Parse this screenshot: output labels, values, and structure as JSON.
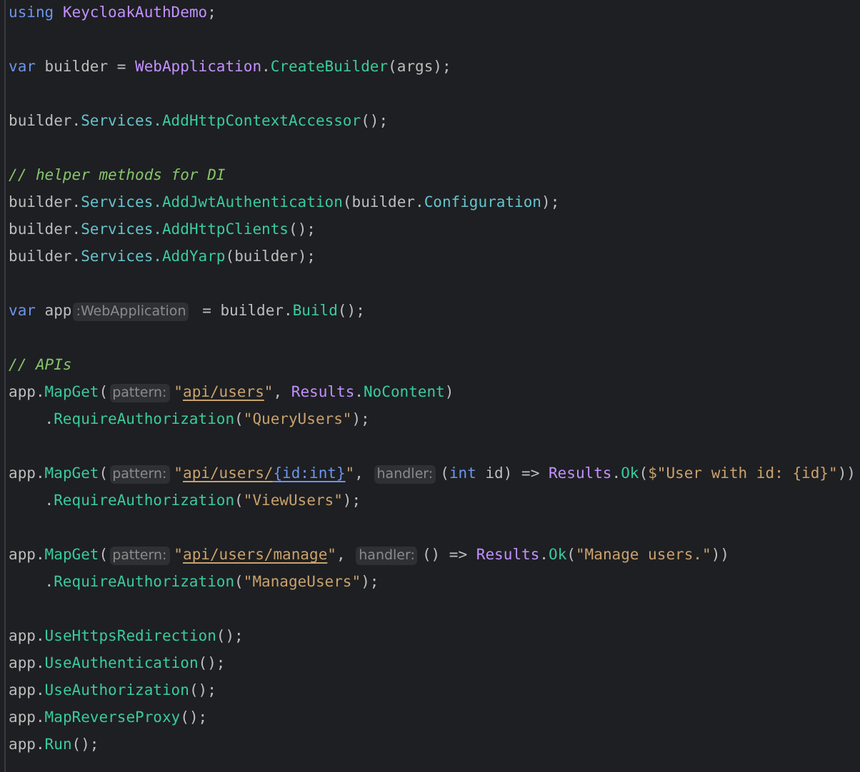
{
  "editor": {
    "lines": [
      {
        "kind": "code",
        "tokens": [
          {
            "kind": "keyword",
            "text": "using "
          },
          {
            "kind": "type",
            "text": "KeycloakAuthDemo"
          },
          {
            "kind": "plain",
            "text": ";"
          }
        ]
      },
      {
        "kind": "blank"
      },
      {
        "kind": "code",
        "tokens": [
          {
            "kind": "keyword",
            "text": "var"
          },
          {
            "kind": "plain",
            "text": " builder = "
          },
          {
            "kind": "type",
            "text": "WebApplication"
          },
          {
            "kind": "plain",
            "text": "."
          },
          {
            "kind": "method",
            "text": "CreateBuilder"
          },
          {
            "kind": "plain",
            "text": "(args);"
          }
        ]
      },
      {
        "kind": "blank"
      },
      {
        "kind": "code",
        "tokens": [
          {
            "kind": "plain",
            "text": "builder."
          },
          {
            "kind": "property",
            "text": "Services."
          },
          {
            "kind": "method",
            "text": "AddHttpContextAccessor"
          },
          {
            "kind": "plain",
            "text": "();"
          }
        ]
      },
      {
        "kind": "blank"
      },
      {
        "kind": "code",
        "tokens": [
          {
            "kind": "comment",
            "text": "// helper methods for DI"
          }
        ]
      },
      {
        "kind": "code",
        "tokens": [
          {
            "kind": "plain",
            "text": "builder."
          },
          {
            "kind": "property",
            "text": "Services."
          },
          {
            "kind": "method",
            "text": "AddJwtAuthentication"
          },
          {
            "kind": "plain",
            "text": "(builder."
          },
          {
            "kind": "property",
            "text": "Configuration"
          },
          {
            "kind": "plain",
            "text": ");"
          }
        ]
      },
      {
        "kind": "code",
        "tokens": [
          {
            "kind": "plain",
            "text": "builder."
          },
          {
            "kind": "property",
            "text": "Services."
          },
          {
            "kind": "method",
            "text": "AddHttpClients"
          },
          {
            "kind": "plain",
            "text": "();"
          }
        ]
      },
      {
        "kind": "code",
        "tokens": [
          {
            "kind": "plain",
            "text": "builder."
          },
          {
            "kind": "property",
            "text": "Services."
          },
          {
            "kind": "method",
            "text": "AddYarp"
          },
          {
            "kind": "plain",
            "text": "(builder);"
          }
        ]
      },
      {
        "kind": "blank"
      },
      {
        "kind": "code",
        "tokens": [
          {
            "kind": "keyword",
            "text": "var"
          },
          {
            "kind": "plain",
            "text": " app"
          },
          {
            "kind": "hint",
            "text": ":WebApplication"
          },
          {
            "kind": "plain",
            "text": " = builder."
          },
          {
            "kind": "method",
            "text": "Build"
          },
          {
            "kind": "plain",
            "text": "();"
          }
        ]
      },
      {
        "kind": "blank"
      },
      {
        "kind": "code",
        "tokens": [
          {
            "kind": "comment",
            "text": "// APIs"
          }
        ]
      },
      {
        "kind": "code",
        "tokens": [
          {
            "kind": "plain",
            "text": "app."
          },
          {
            "kind": "method",
            "text": "MapGet"
          },
          {
            "kind": "plain",
            "text": "("
          },
          {
            "kind": "hint",
            "text": "pattern:"
          },
          {
            "kind": "string",
            "text": "\""
          },
          {
            "kind": "route",
            "text": "api/users"
          },
          {
            "kind": "string",
            "text": "\""
          },
          {
            "kind": "plain",
            "text": ", "
          },
          {
            "kind": "type",
            "text": "Results"
          },
          {
            "kind": "plain",
            "text": "."
          },
          {
            "kind": "method",
            "text": "NoContent"
          },
          {
            "kind": "plain",
            "text": ")"
          }
        ]
      },
      {
        "kind": "code",
        "tokens": [
          {
            "kind": "plain",
            "text": "    ."
          },
          {
            "kind": "method",
            "text": "RequireAuthorization"
          },
          {
            "kind": "plain",
            "text": "("
          },
          {
            "kind": "string",
            "text": "\"QueryUsers\""
          },
          {
            "kind": "plain",
            "text": ");"
          }
        ]
      },
      {
        "kind": "blank"
      },
      {
        "kind": "code",
        "tokens": [
          {
            "kind": "plain",
            "text": "app."
          },
          {
            "kind": "method",
            "text": "MapGet"
          },
          {
            "kind": "plain",
            "text": "("
          },
          {
            "kind": "hint",
            "text": "pattern:"
          },
          {
            "kind": "string",
            "text": "\""
          },
          {
            "kind": "route",
            "text": "api/users/"
          },
          {
            "kind": "param",
            "text": "{id:int}"
          },
          {
            "kind": "string",
            "text": "\""
          },
          {
            "kind": "plain",
            "text": ", "
          },
          {
            "kind": "hint",
            "text": "handler:"
          },
          {
            "kind": "plain",
            "text": "("
          },
          {
            "kind": "keyword",
            "text": "int"
          },
          {
            "kind": "plain",
            "text": " id) => "
          },
          {
            "kind": "type",
            "text": "Results"
          },
          {
            "kind": "plain",
            "text": "."
          },
          {
            "kind": "method",
            "text": "Ok"
          },
          {
            "kind": "plain",
            "text": "("
          },
          {
            "kind": "string",
            "text": "$\"User with id: {id}\""
          },
          {
            "kind": "plain",
            "text": "))"
          }
        ]
      },
      {
        "kind": "code",
        "tokens": [
          {
            "kind": "plain",
            "text": "    ."
          },
          {
            "kind": "method",
            "text": "RequireAuthorization"
          },
          {
            "kind": "plain",
            "text": "("
          },
          {
            "kind": "string",
            "text": "\"ViewUsers\""
          },
          {
            "kind": "plain",
            "text": ");"
          }
        ]
      },
      {
        "kind": "blank"
      },
      {
        "kind": "code",
        "tokens": [
          {
            "kind": "plain",
            "text": "app."
          },
          {
            "kind": "method",
            "text": "MapGet"
          },
          {
            "kind": "plain",
            "text": "("
          },
          {
            "kind": "hint",
            "text": "pattern:"
          },
          {
            "kind": "string",
            "text": "\""
          },
          {
            "kind": "route",
            "text": "api/users/manage"
          },
          {
            "kind": "string",
            "text": "\""
          },
          {
            "kind": "plain",
            "text": ", "
          },
          {
            "kind": "hint",
            "text": "handler:"
          },
          {
            "kind": "plain",
            "text": "() => "
          },
          {
            "kind": "type",
            "text": "Results"
          },
          {
            "kind": "plain",
            "text": "."
          },
          {
            "kind": "method",
            "text": "Ok"
          },
          {
            "kind": "plain",
            "text": "("
          },
          {
            "kind": "string",
            "text": "\"Manage users.\""
          },
          {
            "kind": "plain",
            "text": "))"
          }
        ]
      },
      {
        "kind": "code",
        "tokens": [
          {
            "kind": "plain",
            "text": "    ."
          },
          {
            "kind": "method",
            "text": "RequireAuthorization"
          },
          {
            "kind": "plain",
            "text": "("
          },
          {
            "kind": "string",
            "text": "\"ManageUsers\""
          },
          {
            "kind": "plain",
            "text": ");"
          }
        ]
      },
      {
        "kind": "blank"
      },
      {
        "kind": "code",
        "tokens": [
          {
            "kind": "plain",
            "text": "app."
          },
          {
            "kind": "method",
            "text": "UseHttpsRedirection"
          },
          {
            "kind": "plain",
            "text": "();"
          }
        ]
      },
      {
        "kind": "code",
        "tokens": [
          {
            "kind": "plain",
            "text": "app."
          },
          {
            "kind": "method",
            "text": "UseAuthentication"
          },
          {
            "kind": "plain",
            "text": "();"
          }
        ]
      },
      {
        "kind": "code",
        "tokens": [
          {
            "kind": "plain",
            "text": "app."
          },
          {
            "kind": "method",
            "text": "UseAuthorization"
          },
          {
            "kind": "plain",
            "text": "();"
          }
        ]
      },
      {
        "kind": "code",
        "tokens": [
          {
            "kind": "plain",
            "text": "app."
          },
          {
            "kind": "method",
            "text": "MapReverseProxy"
          },
          {
            "kind": "plain",
            "text": "();"
          }
        ]
      },
      {
        "kind": "code",
        "tokens": [
          {
            "kind": "plain",
            "text": "app."
          },
          {
            "kind": "method",
            "text": "Run"
          },
          {
            "kind": "plain",
            "text": "();"
          }
        ]
      }
    ]
  }
}
